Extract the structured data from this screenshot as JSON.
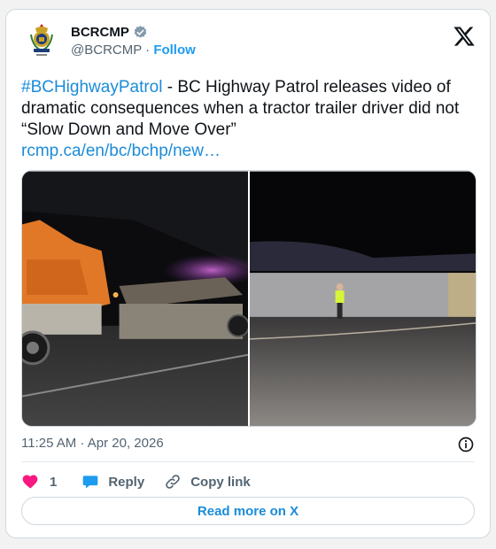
{
  "author": {
    "display_name": "BCRCMP",
    "handle": "@BCRCMP",
    "separator": " · ",
    "follow_label": "Follow",
    "verified": true
  },
  "tweet": {
    "hashtag": "#BCHighwayPatrol",
    "text": " - BC Highway Patrol releases video of dramatic consequences when a tractor trailer driver did not “Slow Down and Move Over”",
    "link": "rcmp.ca/en/bc/bchp/new…"
  },
  "timestamp": "11:25 AM · Apr 20, 2026",
  "actions": {
    "like_count": "1",
    "reply_label": "Reply",
    "copy_label": "Copy link"
  },
  "read_more_label": "Read more on X",
  "colors": {
    "link": "#1b8cd8",
    "heart": "#f91880",
    "reply_bubble": "#1d9bf0",
    "muted_text": "#536471",
    "border": "#cfd9de"
  },
  "icons": [
    "rcmp-crest-icon",
    "verified-badge-icon",
    "x-logo-icon",
    "info-icon",
    "heart-icon",
    "reply-icon",
    "copy-link-icon"
  ]
}
